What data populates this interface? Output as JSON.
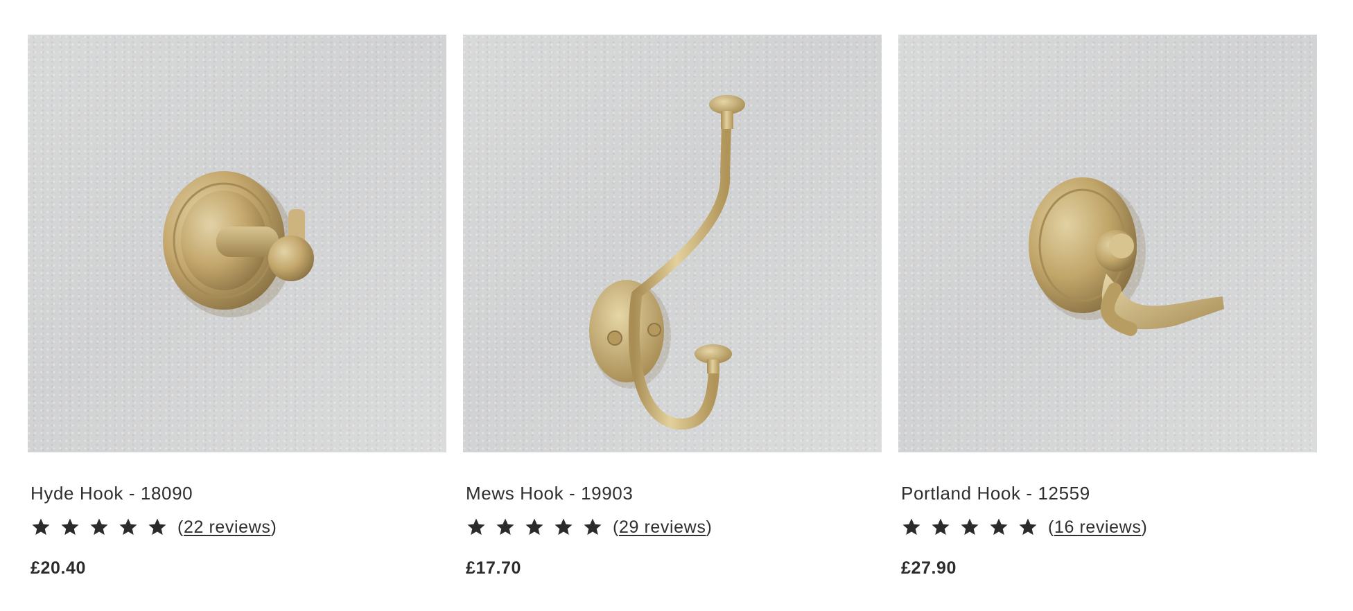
{
  "products": [
    {
      "title": "Hyde Hook - 18090",
      "rating": 5,
      "reviews_open": "(",
      "reviews_link": "22 reviews",
      "reviews_close": ")",
      "price": "£20.40"
    },
    {
      "title": "Mews Hook - 19903",
      "rating": 5,
      "reviews_open": "(",
      "reviews_link": "29 reviews",
      "reviews_close": ")",
      "price": "£17.70"
    },
    {
      "title": "Portland Hook - 12559",
      "rating": 5,
      "reviews_open": "(",
      "reviews_link": "16 reviews",
      "reviews_close": ")",
      "price": "£27.90"
    }
  ],
  "colors": {
    "text": "#2f2f2f",
    "brass": "#c9ae73",
    "wall": "#d5d6d6",
    "star": "#2b2b2b"
  },
  "icons": {
    "star": "star-icon"
  }
}
